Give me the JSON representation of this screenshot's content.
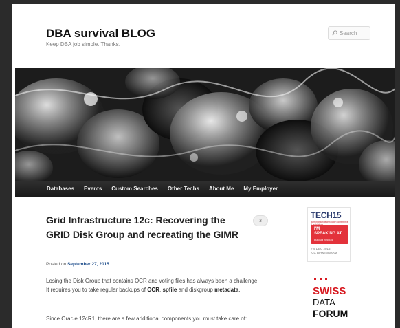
{
  "header": {
    "site_title": "DBA survival BLOG",
    "tagline": "Keep DBA job simple. Thanks.",
    "search_placeholder": "Search"
  },
  "nav": {
    "items": [
      "Databases",
      "Events",
      "Custom Searches",
      "Other Techs",
      "About Me",
      "My Employer"
    ]
  },
  "post": {
    "title": "Grid Infrastructure 12c: Recovering the GRID Disk Group and recreating the GIMR",
    "comment_count": "3",
    "posted_prefix": "Posted on",
    "date": "September 27, 2015",
    "para1_a": "Losing the Disk Group that contains OCR and voting files has always been a challenge. It requires you to take regular backups of",
    "para1_ocr": "OCR",
    "para1_b": ",",
    "para1_spfile": "spfile",
    "para1_c": "and diskgroup",
    "para1_metadata": "metadata",
    "para1_d": ".",
    "para2": "Since Oracle 12cR1, there are a few additional components you must take care of:"
  },
  "sidebar": {
    "tech_badge": {
      "logo": "TECH15",
      "tagline": "Birmingham technology conference & exhibition",
      "line1": "I'M",
      "line2": "SPEAKING AT",
      "line3": "#ukoug_tech15",
      "date": "7-9 DEC 2015",
      "venue": "ICC BIRMINGHAM"
    },
    "sdf_badge": {
      "line1": "SWISS",
      "line2": "DATA",
      "line3": "FORUM"
    }
  },
  "colors": {
    "frame": "#2b2b2b",
    "nav_bg": "#222222",
    "link": "#1b4b8a",
    "tech_red": "#e3323b",
    "sdf_red": "#d71920"
  }
}
